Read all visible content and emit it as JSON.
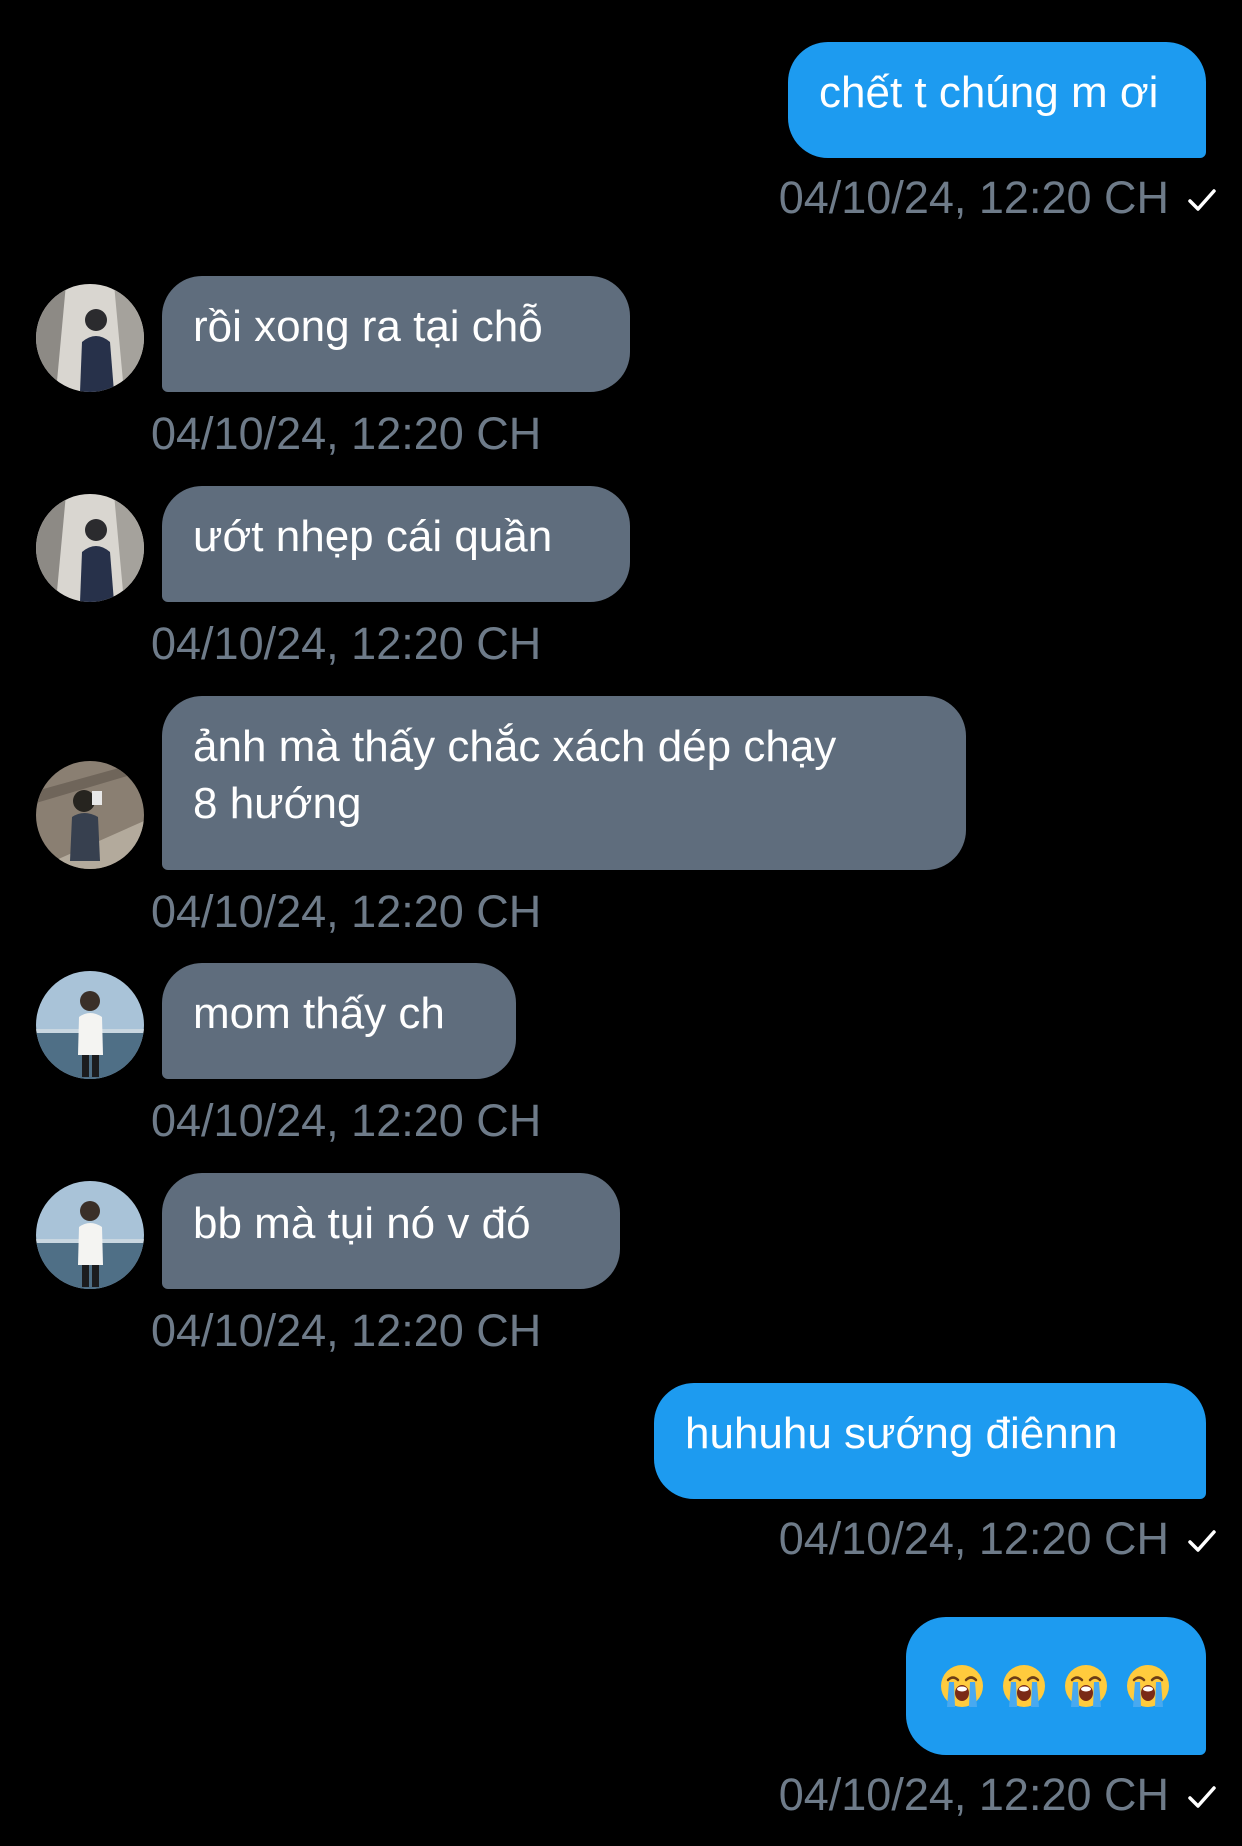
{
  "colors": {
    "background": "#000000",
    "outgoing_bubble": "#1d9bf0",
    "incoming_bubble": "#5f6d7d",
    "timestamp": "#6e7b89"
  },
  "messages": [
    {
      "direction": "outgoing",
      "lines": [
        "chết t chúng m ơi"
      ],
      "timestamp": "04/10/24, 12:20 CH",
      "read_receipt": "check-icon"
    },
    {
      "direction": "incoming",
      "avatar": "avatar-1",
      "lines": [
        "rồi xong ra tại chỗ"
      ],
      "timestamp": "04/10/24, 12:20 CH"
    },
    {
      "direction": "incoming",
      "avatar": "avatar-1",
      "lines": [
        "ướt nhẹp cái quần"
      ],
      "timestamp": "04/10/24, 12:20 CH"
    },
    {
      "direction": "incoming",
      "avatar": "avatar-2",
      "lines": [
        "ảnh mà thấy chắc xách dép chạy",
        "8 hướng"
      ],
      "timestamp": "04/10/24, 12:20 CH"
    },
    {
      "direction": "incoming",
      "avatar": "avatar-3",
      "lines": [
        "mom thấy ch"
      ],
      "timestamp": "04/10/24, 12:20 CH"
    },
    {
      "direction": "incoming",
      "avatar": "avatar-3",
      "lines": [
        "bb mà tụi nó v đó"
      ],
      "timestamp": "04/10/24, 12:20 CH"
    },
    {
      "direction": "outgoing",
      "lines": [
        "huhuhu sướng điênnn"
      ],
      "timestamp": "04/10/24, 12:20 CH",
      "read_receipt": "check-icon"
    },
    {
      "direction": "outgoing",
      "emoji": [
        "loudly-crying-face-emoji",
        "loudly-crying-face-emoji",
        "loudly-crying-face-emoji",
        "loudly-crying-face-emoji"
      ],
      "timestamp": "04/10/24, 12:20 CH",
      "read_receipt": "check-icon"
    }
  ]
}
